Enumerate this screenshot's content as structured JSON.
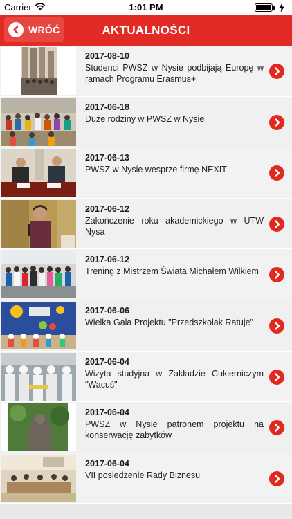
{
  "status_bar": {
    "carrier": "Carrier",
    "time": "1:01 PM"
  },
  "nav": {
    "back_label": "WRÓĆ",
    "title": "AKTUALNOŚCI"
  },
  "colors": {
    "accent": "#e22b24",
    "arrow": "#e1291f"
  },
  "news": [
    {
      "date": "2017-08-10",
      "title": "Studenci PWSZ w Nysie podbijają Europę w ramach Programu Erasmus+"
    },
    {
      "date": "2017-06-18",
      "title": "Duże rodziny w PWSZ w Nysie"
    },
    {
      "date": "2017-06-13",
      "title": "PWSZ w Nysie wesprze firmę NEXIT"
    },
    {
      "date": "2017-06-12",
      "title": "Zakończenie roku akademickiego w UTW Nysa"
    },
    {
      "date": "2017-06-12",
      "title": "Trening z Mistrzem Świata Michałem Wilkiem"
    },
    {
      "date": "2017-06-06",
      "title": "Wielka Gala Projektu \"Przedszkolak Ratuje\""
    },
    {
      "date": "2017-06-04",
      "title": "Wizyta studyjna w Zakładzie Cukierniczym \"Wacuś\""
    },
    {
      "date": "2017-06-04",
      "title": "PWSZ w Nysie patronem projektu na konserwację zabytków"
    },
    {
      "date": "2017-06-04",
      "title": "VII posiedzenie Rady Biznesu"
    }
  ]
}
